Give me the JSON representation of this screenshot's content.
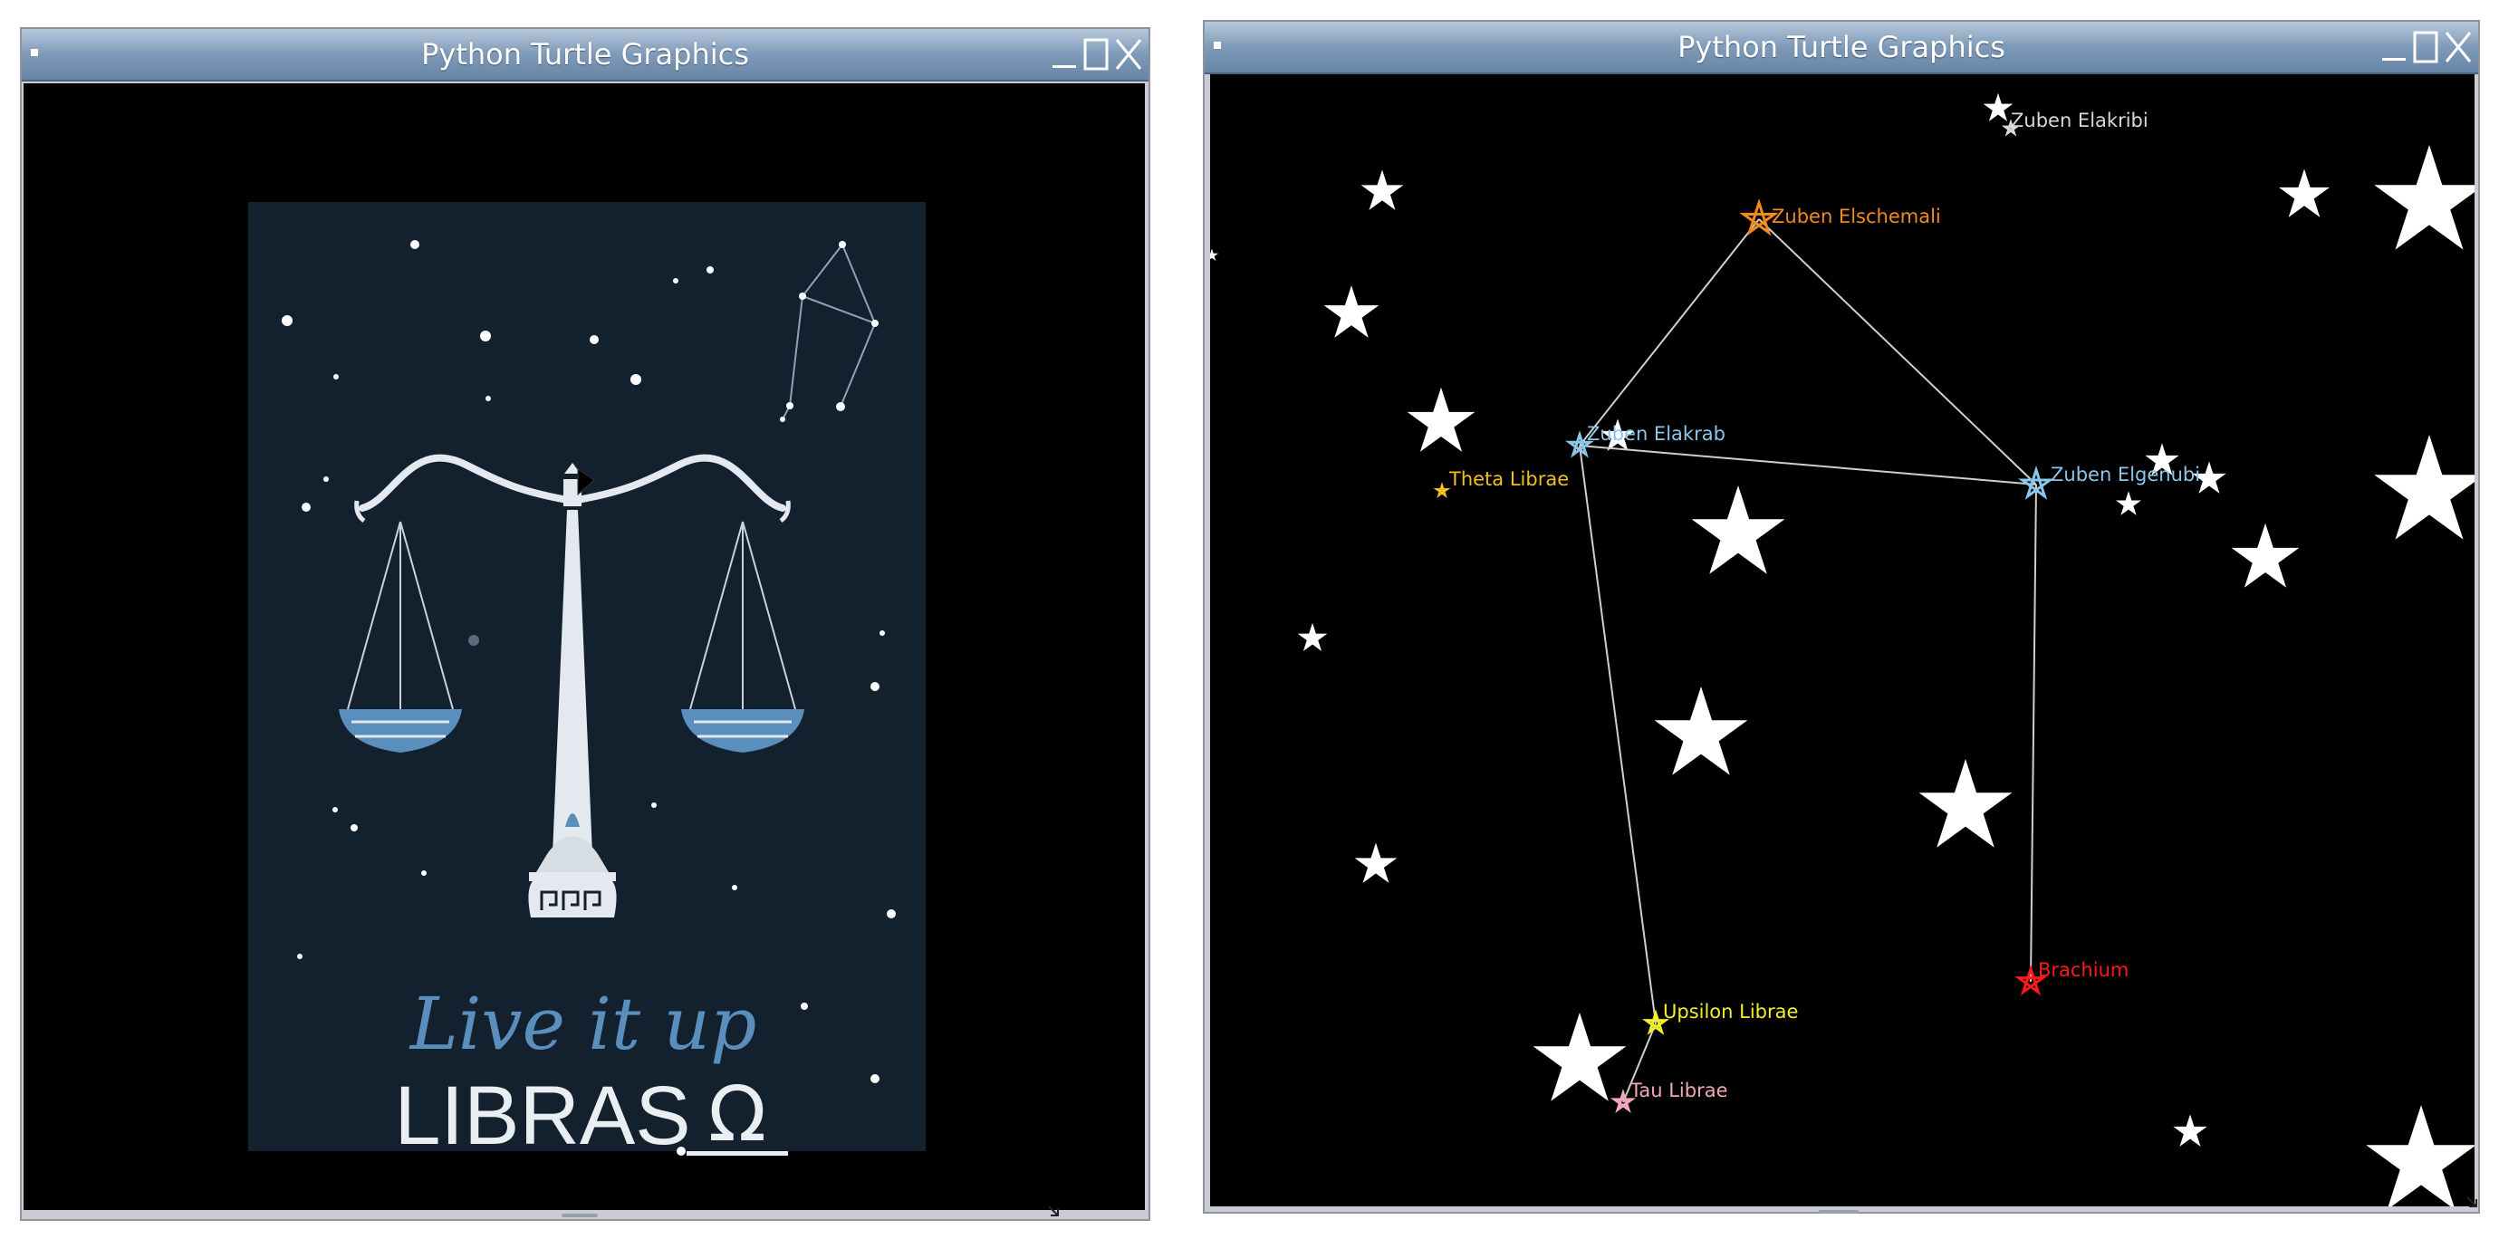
{
  "windows": [
    {
      "title": "Python Turtle Graphics"
    },
    {
      "title": "Python Turtle Graphics"
    }
  ],
  "poster": {
    "script_text": "Live it up",
    "main_text": "LIBRAS",
    "symbol": "Ω",
    "colors": {
      "background": "#13202e",
      "accent": "#5a8fbd",
      "ink": "#e9eef2"
    }
  },
  "constellation": {
    "lines_color": "#cfcfcf",
    "stars": [
      {
        "name": "Zuben Elakribi",
        "color": "#d8d8d8"
      },
      {
        "name": "Zuben Elschemali",
        "color": "#f28a1f"
      },
      {
        "name": "Zuben Elakrab",
        "color": "#8cc6ea"
      },
      {
        "name": "Zuben Elgenubi",
        "color": "#8cc6ea"
      },
      {
        "name": "Theta Librae",
        "color": "#f0c020"
      },
      {
        "name": "Brachium",
        "color": "#ff1a1a"
      },
      {
        "name": "Upsilon Librae",
        "color": "#f2ef2a"
      },
      {
        "name": "Tau Librae",
        "color": "#f4a7b9"
      }
    ]
  }
}
